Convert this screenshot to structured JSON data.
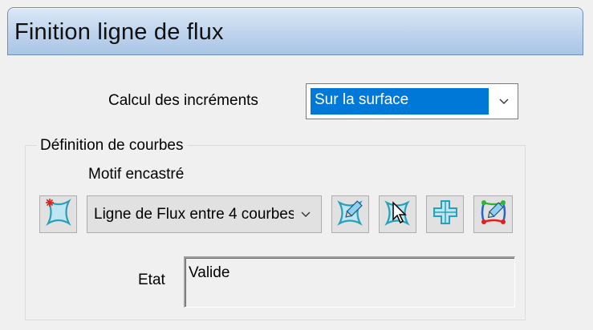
{
  "window": {
    "title": "Finition ligne de flux"
  },
  "increments": {
    "label": "Calcul des incréments",
    "selected": "Sur la surface"
  },
  "curves": {
    "group_label": "Définition de courbes",
    "pattern_label": "Motif encastré",
    "pattern_selected": "Ligne de Flux entre 4 courbes"
  },
  "state": {
    "label": "Etat",
    "value": "Valide"
  },
  "icons": {
    "new": "new-star-curve-icon",
    "edit": "edit-curve-pencil-icon",
    "select": "select-curve-cursor-icon",
    "cross": "cross-shape-icon",
    "boundary": "boundary-edit-icon"
  },
  "colors": {
    "accent": "#0078d7",
    "title_gradient_top": "#dbe8f6",
    "title_gradient_bottom": "#a9c5e6",
    "icon_teal": "#2aa0b8",
    "icon_red": "#e02020",
    "icon_green": "#2fb52f"
  }
}
